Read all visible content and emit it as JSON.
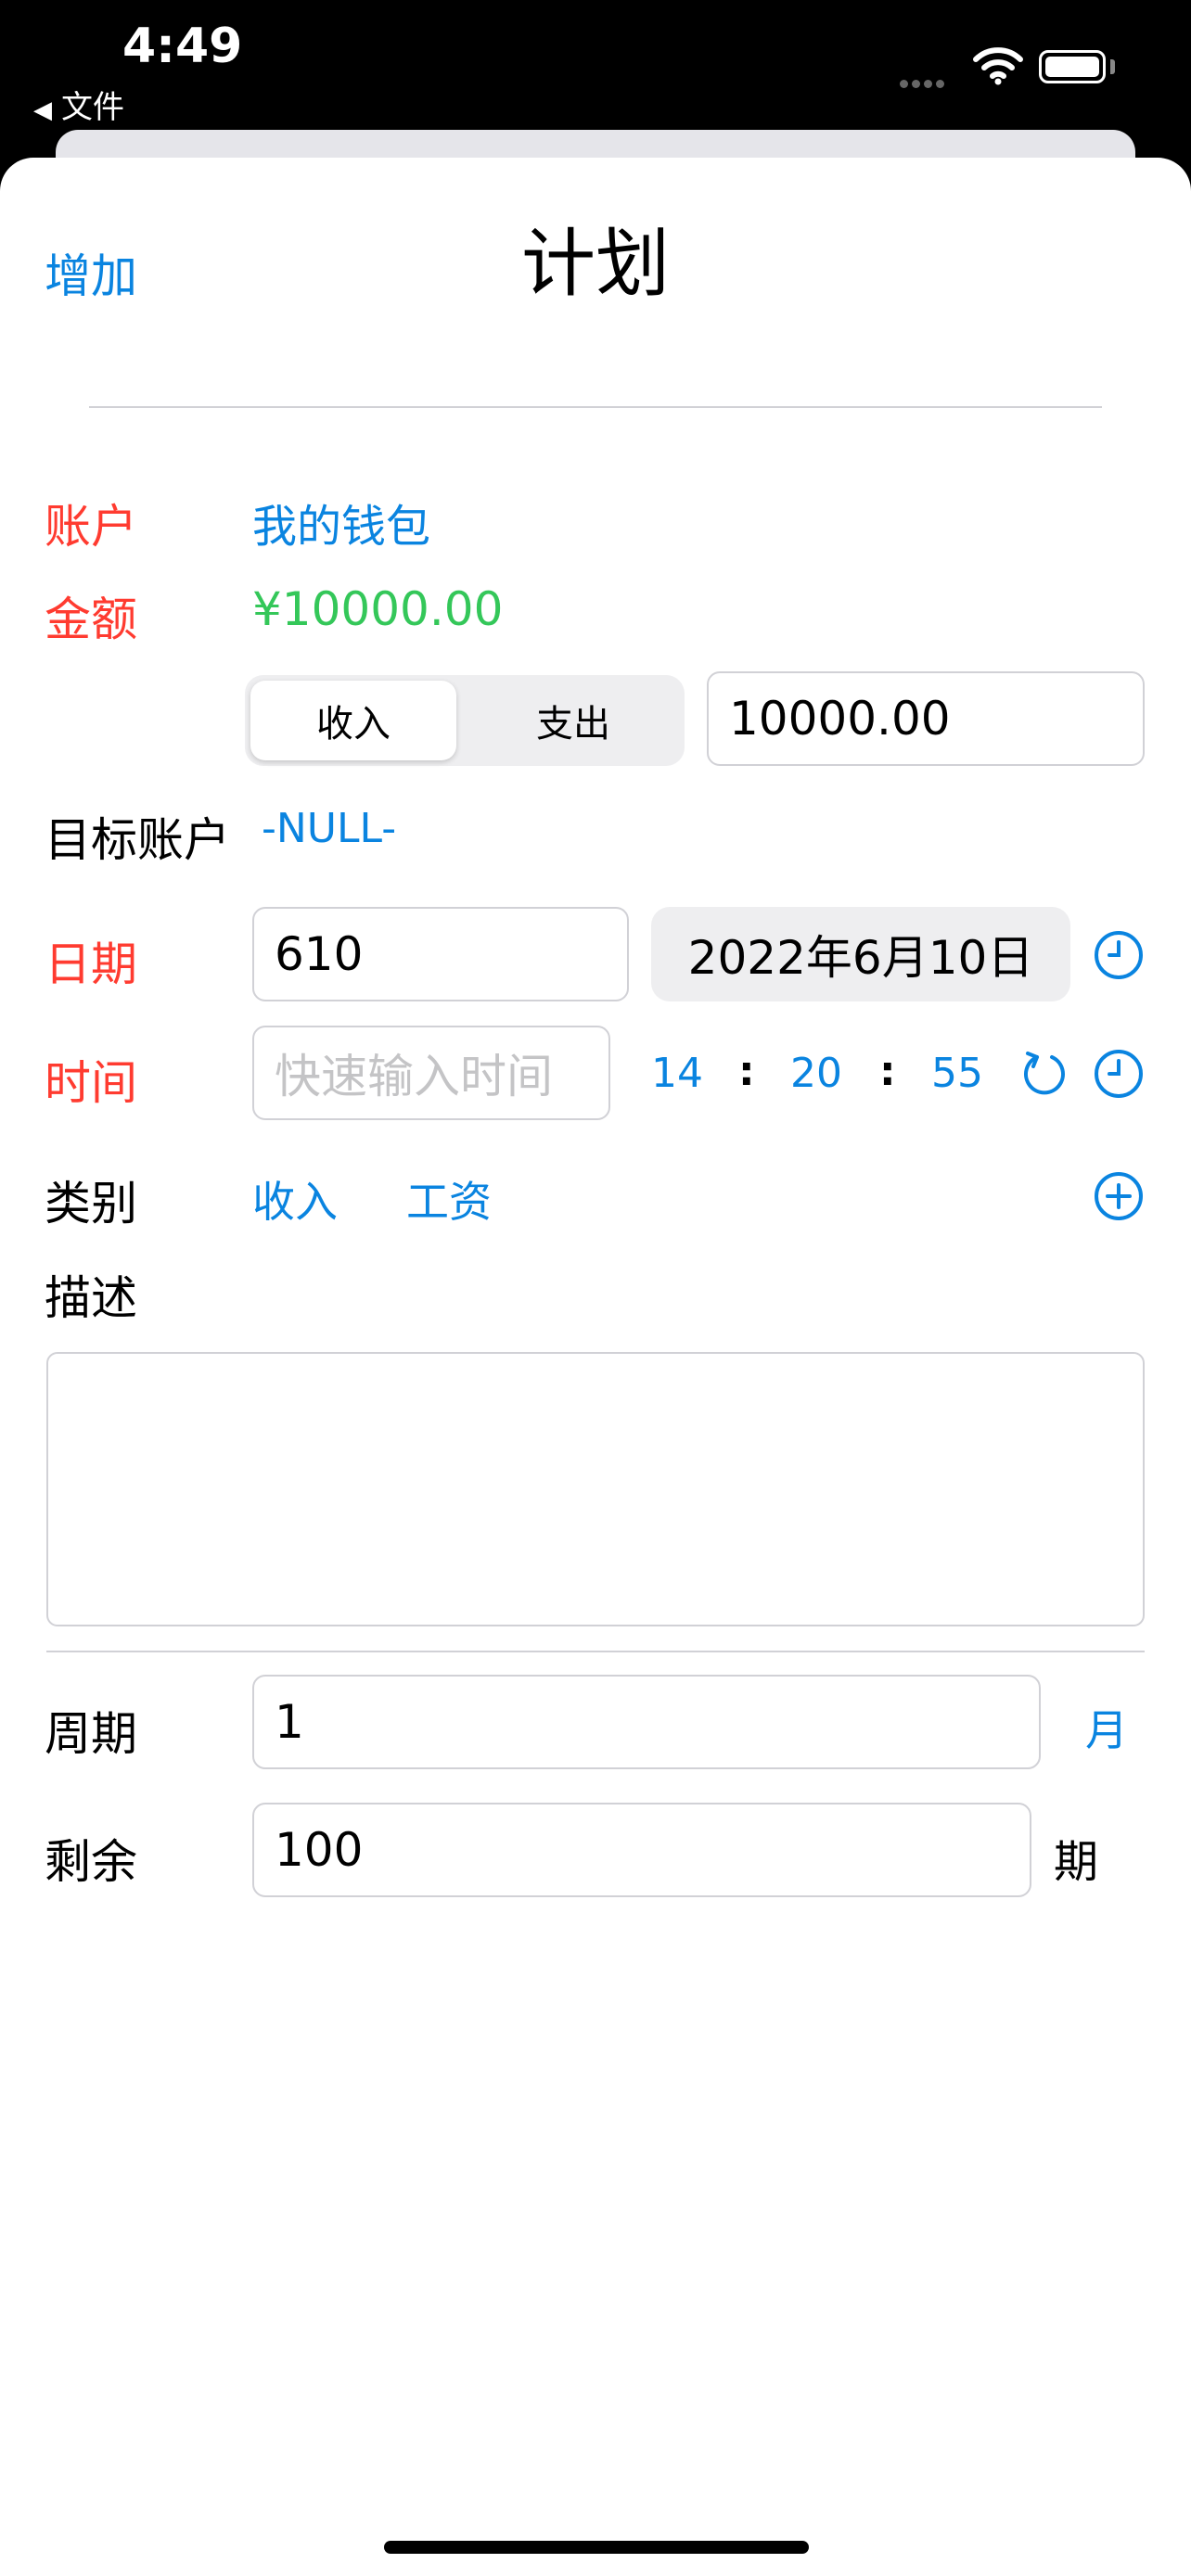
{
  "status_bar": {
    "time": "4:49",
    "back_app": "文件"
  },
  "nav": {
    "add": "增加",
    "title": "计划"
  },
  "account": {
    "label": "账户",
    "value": "我的钱包"
  },
  "amount": {
    "label": "金额",
    "value": "¥10000.00",
    "input": "10000.00"
  },
  "type_segment": {
    "options": [
      "收入",
      "支出"
    ],
    "selected": "收入"
  },
  "target_account": {
    "label": "目标账户",
    "value": "-NULL-"
  },
  "date": {
    "label": "日期",
    "input": "610",
    "display": "2022年6月10日"
  },
  "time": {
    "label": "时间",
    "placeholder": "快速输入时间",
    "hour": "14",
    "minute": "20",
    "second": "55",
    "separator": ":"
  },
  "category": {
    "label": "类别",
    "primary": "收入",
    "secondary": "工资"
  },
  "description": {
    "label": "描述",
    "value": ""
  },
  "period": {
    "label": "周期",
    "value": "1",
    "unit": "月"
  },
  "remaining": {
    "label": "剩余",
    "value": "100",
    "unit": "期"
  },
  "colors": {
    "accent": "#0a84e0",
    "label_red": "#ff3b30",
    "amount_green": "#34c759"
  }
}
